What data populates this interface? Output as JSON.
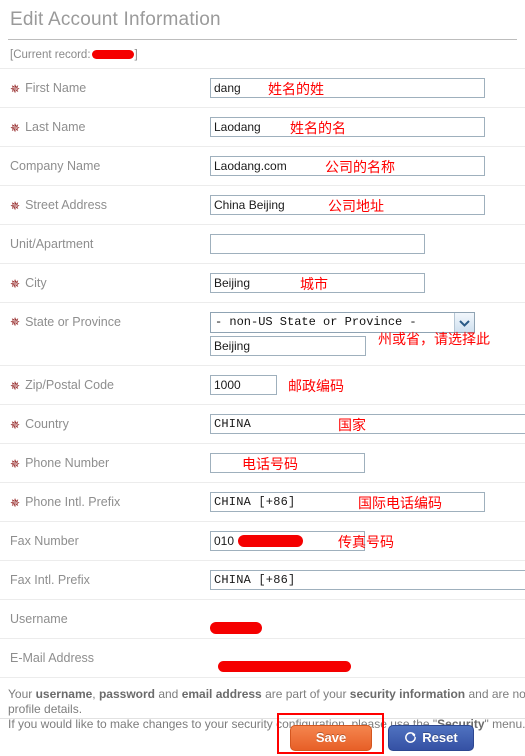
{
  "page": {
    "title": "Edit Account Information",
    "current_record_label": "[Current record:",
    "current_record_close": "]"
  },
  "fields": {
    "first_name": {
      "label": "First Name",
      "required": true,
      "value": "dang",
      "annotation": "姓名的姓"
    },
    "last_name": {
      "label": "Last Name",
      "required": true,
      "value": "Laodang",
      "annotation": "姓名的名"
    },
    "company": {
      "label": "Company Name",
      "required": false,
      "value": "Laodang.com",
      "annotation": "公司的名称"
    },
    "street": {
      "label": "Street Address",
      "required": true,
      "value": "China Beijing",
      "annotation": "公司地址"
    },
    "unit": {
      "label": "Unit/Apartment",
      "required": false,
      "value": "",
      "annotation": ""
    },
    "city": {
      "label": "City",
      "required": true,
      "value": "Beijing",
      "annotation": "城市"
    },
    "state": {
      "label": "State or Province",
      "required": true,
      "selected_option": "- non-US State or Province -",
      "sub_value": "Beijing",
      "annotation": "州或省，请选择此"
    },
    "zip": {
      "label": "Zip/Postal Code",
      "required": true,
      "value": "1000",
      "annotation": "邮政编码"
    },
    "country": {
      "label": "Country",
      "required": true,
      "value": "CHINA",
      "annotation": "国家"
    },
    "phone": {
      "label": "Phone Number",
      "required": true,
      "value": "",
      "annotation": "电话号码"
    },
    "phone_prefix": {
      "label": "Phone Intl. Prefix",
      "required": true,
      "value": "CHINA [+86]",
      "annotation": "国际电话编码"
    },
    "fax": {
      "label": "Fax Number",
      "required": false,
      "value": "010",
      "annotation": "传真号码"
    },
    "fax_prefix": {
      "label": "Fax Intl. Prefix",
      "required": false,
      "value": "CHINA [+86]",
      "annotation": ""
    },
    "username": {
      "label": "Username",
      "required": false,
      "value": "",
      "annotation": ""
    },
    "email": {
      "label": "E-Mail Address",
      "required": false,
      "value": "",
      "annotation": ""
    }
  },
  "footer": {
    "line1_a": "Your ",
    "line1_b": "username",
    "line1_c": ", ",
    "line1_d": "password",
    "line1_e": " and ",
    "line1_f": "email address",
    "line1_g": " are part of your ",
    "line1_h": "security information",
    "line1_i": " and are not editable as part of your",
    "line2": "profile details.",
    "line3_a": "If you would like to make changes to your security configuration, please use the \"",
    "line3_b": "Security",
    "line3_c": "\" menu."
  },
  "buttons": {
    "save": "Save",
    "reset": "Reset"
  },
  "icons": {
    "dropdown": "chevron-down-icon",
    "reset": "circular-arrow-icon",
    "required": "required-star-icon"
  },
  "colors": {
    "save_button": "#e75f27",
    "reset_button": "#3551a4",
    "annotation": "#ff0000",
    "redaction": "#f50000",
    "required_star": "#8c1616"
  }
}
